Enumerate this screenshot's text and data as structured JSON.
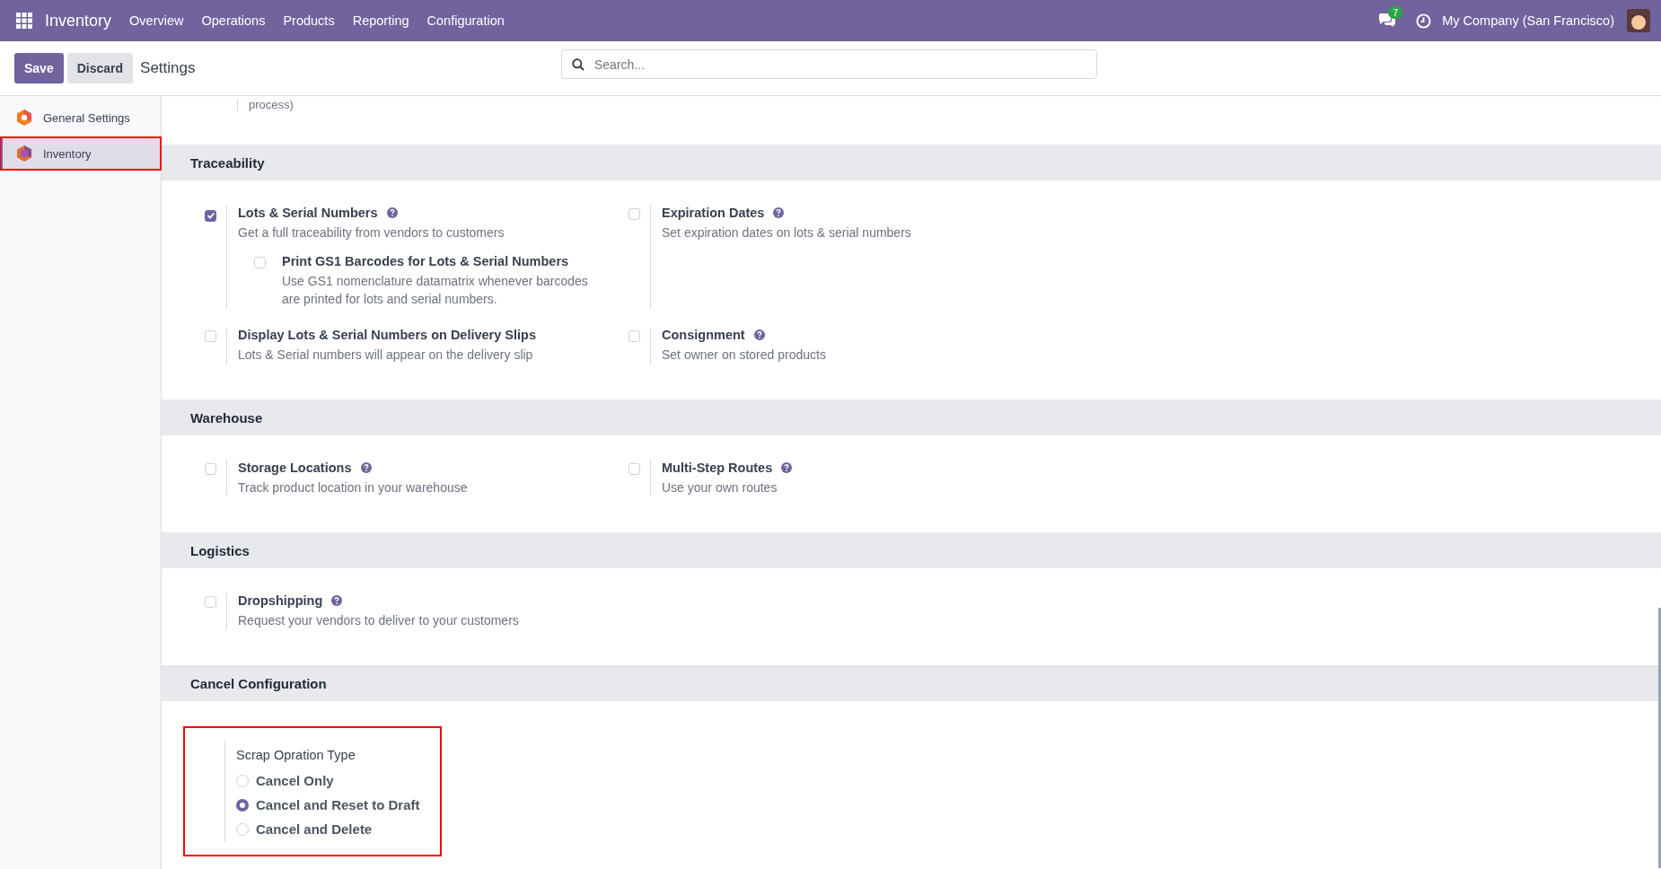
{
  "navbar": {
    "app_name": "Inventory",
    "menu": [
      "Overview",
      "Operations",
      "Products",
      "Reporting",
      "Configuration"
    ],
    "message_count": "7",
    "company": "My Company (San Francisco)"
  },
  "control_panel": {
    "buttons": [
      "Save",
      "Discard"
    ],
    "title": "Settings",
    "search": {
      "placeholder": "Search..."
    }
  },
  "sidebar": {
    "items": [
      {
        "label": "General Settings",
        "selected": false,
        "highlighted": false
      },
      {
        "label": "Inventory",
        "selected": true,
        "highlighted": true
      }
    ]
  },
  "top_fragment": "process)",
  "sections": [
    {
      "title": "Traceability",
      "settings": [
        {
          "kind": "checkbox",
          "title": "Lots & Serial Numbers",
          "help": true,
          "description": "Get a full traceability from vendors to customers",
          "checked": true,
          "sub": {
            "title": "Print GS1 Barcodes for Lots & Serial Numbers",
            "description": "Use GS1 nomenclature datamatrix whenever barcodes are printed for lots and serial numbers.",
            "checked": false
          }
        },
        {
          "kind": "checkbox",
          "title": "Expiration Dates",
          "help": true,
          "description": "Set expiration dates on lots & serial numbers",
          "checked": false
        },
        {
          "kind": "checkbox",
          "title": "Display Lots & Serial Numbers on Delivery Slips",
          "description": "Lots & Serial numbers will appear on the delivery slip",
          "checked": false
        },
        {
          "kind": "checkbox",
          "title": "Consignment",
          "help": true,
          "description": "Set owner on stored products",
          "checked": false
        }
      ]
    },
    {
      "title": "Warehouse",
      "settings": [
        {
          "kind": "checkbox",
          "title": "Storage Locations",
          "help": true,
          "description": "Track product location in your warehouse",
          "checked": false
        },
        {
          "kind": "checkbox",
          "title": "Multi-Step Routes",
          "help": true,
          "description": "Use your own routes",
          "checked": false
        }
      ]
    },
    {
      "title": "Logistics",
      "settings": [
        {
          "kind": "checkbox",
          "title": "Dropshipping",
          "help": true,
          "description": "Request your vendors to deliver to your customers",
          "checked": false
        }
      ]
    },
    {
      "title": "Cancel Configuration",
      "settings": [
        {
          "kind": "radio",
          "title": "Scrap Opration Type",
          "highlighted": true,
          "options": [
            {
              "label": "Cancel Only",
              "selected": false
            },
            {
              "label": "Cancel and Reset to Draft",
              "selected": true
            },
            {
              "label": "Cancel and Delete",
              "selected": false
            }
          ]
        }
      ]
    }
  ]
}
